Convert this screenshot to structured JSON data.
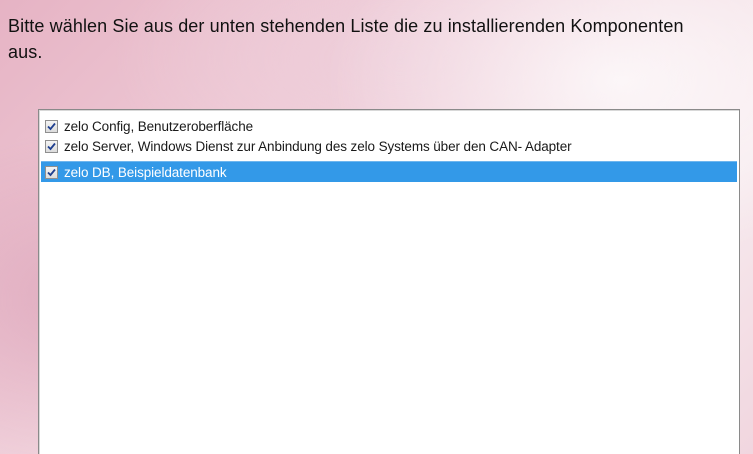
{
  "instruction": "Bitte wählen Sie aus der unten stehenden Liste die zu installierenden Komponenten aus.",
  "components": [
    {
      "label": "zelo Config, Benutzeroberfläche",
      "checked": true,
      "selected": false
    },
    {
      "label": "zelo Server, Windows Dienst zur Anbindung des zelo Systems über den CAN- Adapter",
      "checked": true,
      "selected": false
    },
    {
      "label": "zelo DB, Beispieldatenbank",
      "checked": true,
      "selected": true
    }
  ],
  "colors": {
    "selection": "#3399e8",
    "check": "#1f3f8f"
  }
}
